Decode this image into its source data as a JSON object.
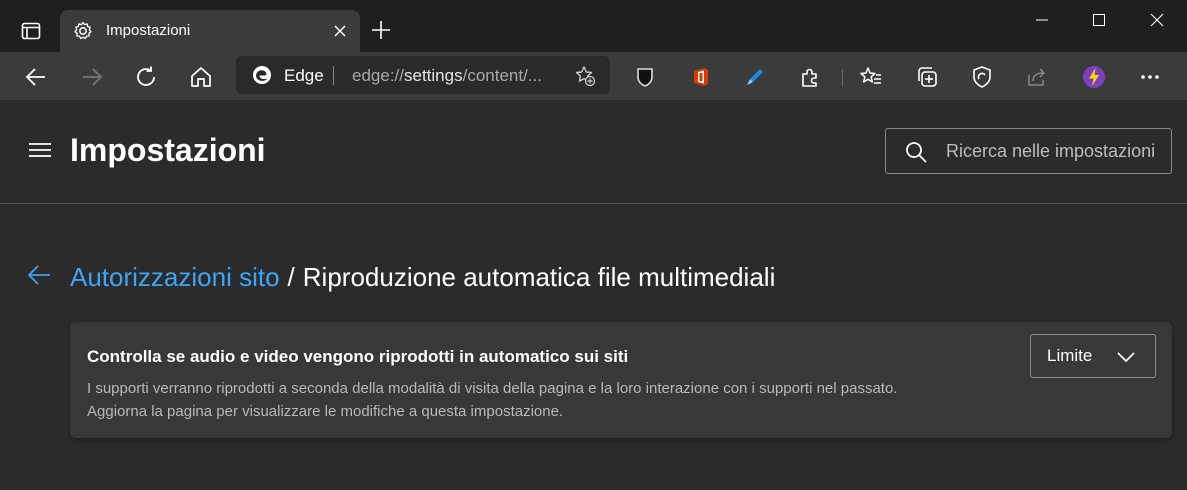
{
  "browser": {
    "tab": {
      "title": "Impostazioni",
      "icon": "gear-icon"
    },
    "window_controls": [
      "minimize-icon",
      "maximize-icon",
      "close-icon"
    ],
    "address": {
      "site_label": "Edge",
      "url_scheme": "edge://",
      "url_host": "settings",
      "url_rest": "/content/..."
    },
    "toolbar_icons": [
      "back-icon",
      "forward-icon",
      "refresh-icon",
      "home-icon",
      "add-favorite-icon",
      "extension-shield-icon",
      "office-icon",
      "extension-pen-icon",
      "extensions-icon",
      "favorites-icon",
      "collections-icon",
      "browser-essentials-icon",
      "share-icon",
      "profile-icon",
      "more-icon"
    ]
  },
  "settings": {
    "header_title": "Impostazioni",
    "search_placeholder": "Ricerca nelle impostazioni"
  },
  "breadcrumb": {
    "parent": "Autorizzazioni sito",
    "separator": "/",
    "current": "Riproduzione automatica file multimediali"
  },
  "card": {
    "title": "Controlla se audio e video vengono riprodotti in automatico sui siti",
    "description_line1": "I supporti verranno riprodotti a seconda della modalità di visita della pagina e la loro interazione con i supporti nel passato.",
    "description_line2": "Aggiorna la pagina per visualizzare le modifiche a questa impostazione.",
    "dropdown_value": "Limite"
  },
  "colors": {
    "accent": "#3ea5f5",
    "page_bg": "#2b2b2b",
    "card_bg": "#383838",
    "titlebar_bg": "#1f1f1f",
    "toolbar_bg": "#3b3b3b"
  }
}
